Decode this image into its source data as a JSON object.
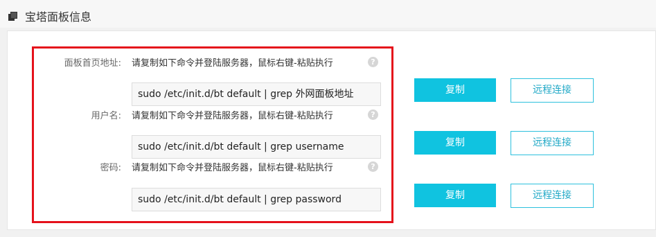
{
  "header": {
    "title": "宝塔面板信息",
    "icon": "copy-stack-icon"
  },
  "colors": {
    "accent": "#10c3e0",
    "highlight_border": "#e5111b"
  },
  "rows": [
    {
      "label": "面板首页地址:",
      "hint": "请复制如下命令并登陆服务器，鼠标右键-粘贴执行",
      "command": "sudo /etc/init.d/bt default | grep 外网面板地址",
      "copy_label": "复制",
      "remote_label": "远程连接"
    },
    {
      "label": "用户名:",
      "hint": "请复制如下命令并登陆服务器，鼠标右键-粘贴执行",
      "command": "sudo /etc/init.d/bt default | grep username",
      "copy_label": "复制",
      "remote_label": "远程连接"
    },
    {
      "label": "密码:",
      "hint": "请复制如下命令并登陆服务器，鼠标右键-粘贴执行",
      "command": "sudo /etc/init.d/bt default | grep password",
      "copy_label": "复制",
      "remote_label": "远程连接"
    }
  ]
}
